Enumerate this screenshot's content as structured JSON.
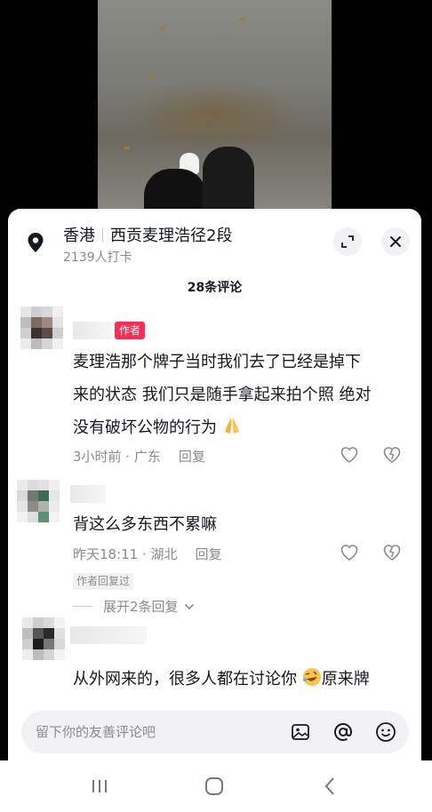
{
  "location": {
    "city": "香港",
    "place": "西贡麦理浩径2段",
    "checkins": "2139人打卡"
  },
  "comments_header": {
    "count_label": "28条评论"
  },
  "comments": [
    {
      "author_tag": "作者",
      "text_lines": [
        "麦理浩那个牌子当时我们去了已经是掉下",
        "来的状态 我们只是随手拿起来拍个照 绝对",
        "没有破坏公物的行为"
      ],
      "emoji": "praying-hands",
      "meta": "3小时前 · 广东",
      "reply_label": "回复"
    },
    {
      "text_lines": [
        "背这么多东西不累嘛"
      ],
      "meta": "昨天18:11 · 湖北",
      "reply_label": "回复",
      "author_replied": "作者回复过",
      "expand_label": "展开2条回复"
    },
    {
      "text_lines": [
        "从外网来的，很多人都在讨论你",
        "原来牌"
      ],
      "emoji": "rofl-face"
    }
  ],
  "input": {
    "placeholder": "留下你的友善评论吧"
  },
  "icons": [
    "location-pin-icon",
    "expand-icon",
    "close-icon",
    "heart-icon",
    "dislike-icon",
    "chevron-down-icon",
    "image-icon",
    "at-icon",
    "emoji-icon",
    "recents-icon",
    "home-icon",
    "back-icon"
  ],
  "colors": {
    "accent": "#fe2c55",
    "secondary_text": "#8a8b91",
    "input_bg": "#f2f2f4"
  }
}
